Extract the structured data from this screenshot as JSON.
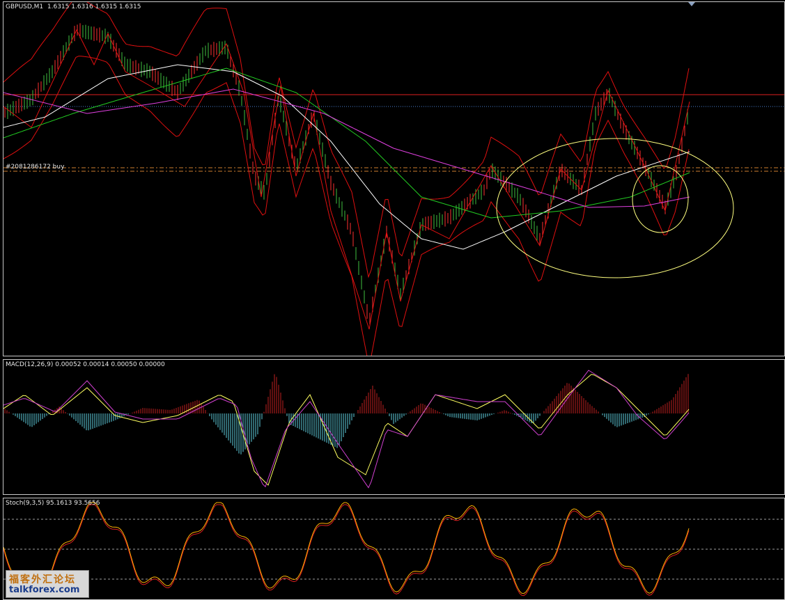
{
  "main_pane": {
    "label": "GBPUSD,M1  1.6315 1.6316 1.6315 1.6315",
    "order_label": "#2081286172 buy"
  },
  "macd_pane": {
    "label": "MACD(12,26,9) 0.00052 0.00014 0.00050 0.00000"
  },
  "stoch_pane": {
    "label": "Stoch(9,3,5) 95.1613 93.5656"
  },
  "watermark": {
    "cn": "福客外汇论坛",
    "url": "talkforex.com"
  },
  "colors": {
    "background": "#000000",
    "bull_candle": "#3fbf3f",
    "bear_candle": "#ff3030",
    "bollinger": "#e01010",
    "ma_white": "#ffffff",
    "ma_green": "#22cc22",
    "ma_magenta": "#e040e0",
    "hline_red": "#e02020",
    "hline_blue": "#4a7fd0",
    "order_line": "#d08030",
    "annotation": "#ffff80",
    "macd_pos": "#c02020",
    "macd_neg": "#60d0e0",
    "macd_signal": "#ffff60",
    "macd_line": "#d040d0",
    "stoch_main": "#ffb000",
    "stoch_signal": "#e02020"
  }
}
